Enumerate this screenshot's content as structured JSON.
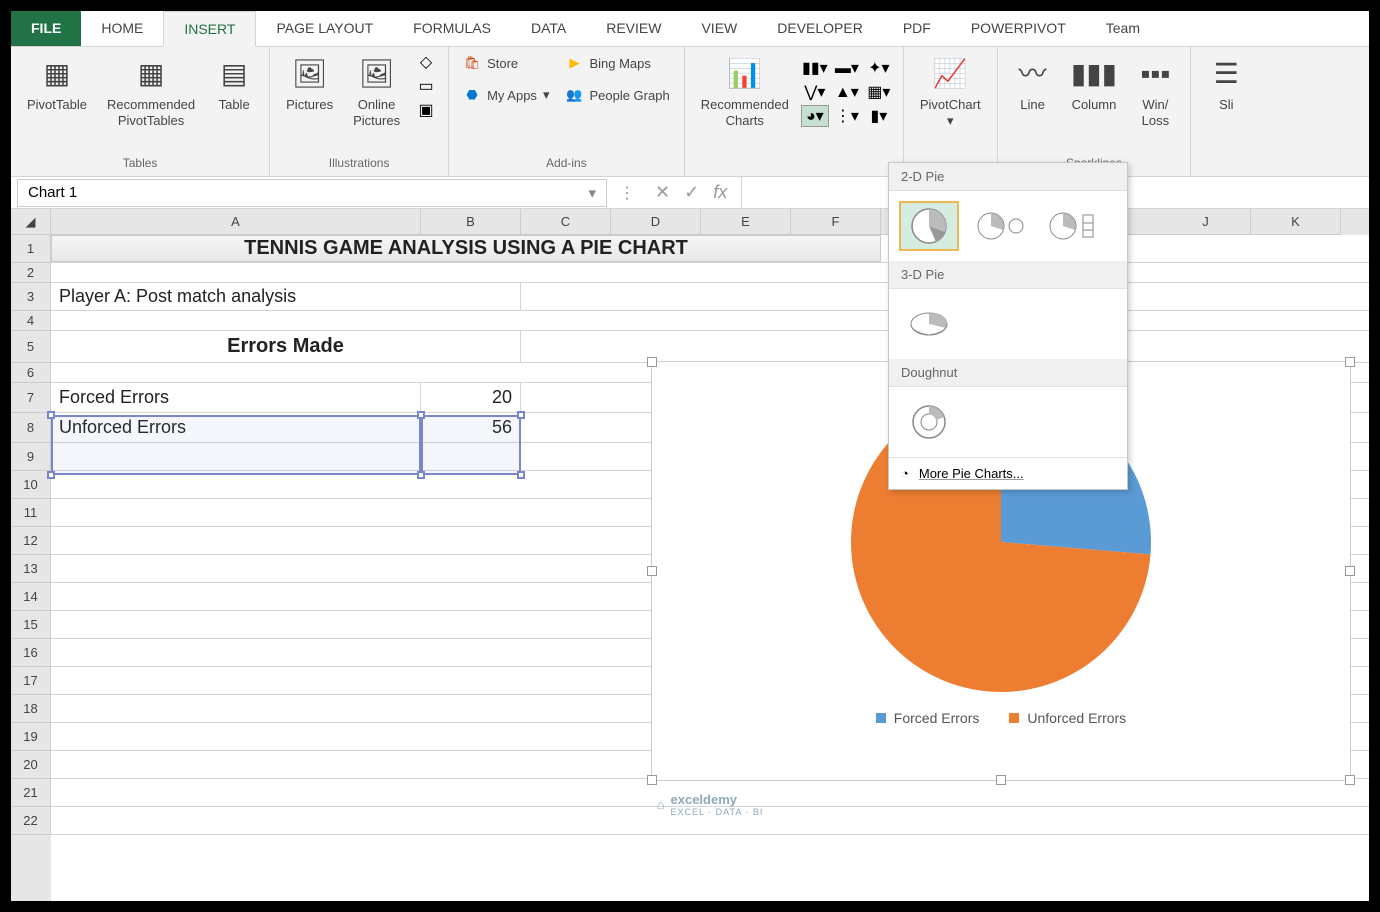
{
  "tabs": {
    "file": "FILE",
    "home": "HOME",
    "insert": "INSERT",
    "page_layout": "PAGE LAYOUT",
    "formulas": "FORMULAS",
    "data": "DATA",
    "review": "REVIEW",
    "view": "VIEW",
    "developer": "DEVELOPER",
    "pdf": "PDF",
    "powerpivot": "POWERPIVOT",
    "team": "Team"
  },
  "ribbon": {
    "tables": {
      "pivot": "PivotTable",
      "rec_pivot": "Recommended\nPivotTables",
      "table": "Table",
      "label": "Tables"
    },
    "illustrations": {
      "pictures": "Pictures",
      "online": "Online\nPictures",
      "label": "Illustrations"
    },
    "addins": {
      "store": "Store",
      "myapps": "My Apps",
      "bing": "Bing Maps",
      "people": "People Graph",
      "label": "Add-ins"
    },
    "charts": {
      "rec": "Recommended\nCharts"
    },
    "pivotchart": "PivotChart",
    "sparklines": {
      "line": "Line",
      "column": "Column",
      "winloss": "Win/\nLoss",
      "label": "Sparklines"
    },
    "slicer": "Sli"
  },
  "pie_menu": {
    "h1": "2-D Pie",
    "h2": "3-D Pie",
    "h3": "Doughnut",
    "more": "More Pie Charts..."
  },
  "namebox": "Chart 1",
  "sheet": {
    "title": "TENNIS GAME ANALYSIS USING A PIE CHART",
    "subtitle": "Player A: Post match analysis",
    "heading": "Errors Made",
    "rows": [
      {
        "label": "Forced Errors",
        "value": "20"
      },
      {
        "label": "Unforced Errors",
        "value": "56"
      }
    ]
  },
  "chart_data": {
    "type": "pie",
    "categories": [
      "Forced Errors",
      "Unforced Errors"
    ],
    "values": [
      20,
      56
    ],
    "colors": [
      "#5b9bd5",
      "#ed7d31"
    ],
    "title": "",
    "legend_position": "bottom"
  },
  "watermark": {
    "name": "exceldemy",
    "tag": "EXCEL · DATA · BI"
  },
  "columns": [
    "A",
    "B",
    "C",
    "D",
    "E",
    "F",
    "J",
    "K"
  ],
  "col_after_gap": [
    "J",
    "K"
  ]
}
